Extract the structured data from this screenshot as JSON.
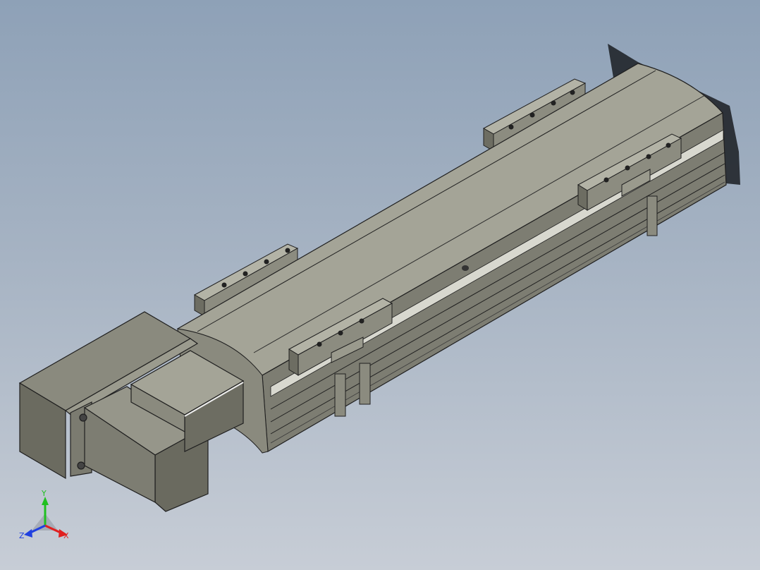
{
  "viewport": {
    "background_top": "#8ea1b7",
    "background_bottom": "#c7cdd6"
  },
  "model": {
    "body_color": "#8f8f84",
    "body_top_color": "#a9a99c",
    "edge_color": "#1f1f1f",
    "motor_color": "#7c7c70"
  },
  "triad": {
    "x_label": "X",
    "y_label": "Y",
    "z_label": "Z",
    "x_color": "#e02020",
    "y_color": "#20c020",
    "z_color": "#2040e0"
  }
}
